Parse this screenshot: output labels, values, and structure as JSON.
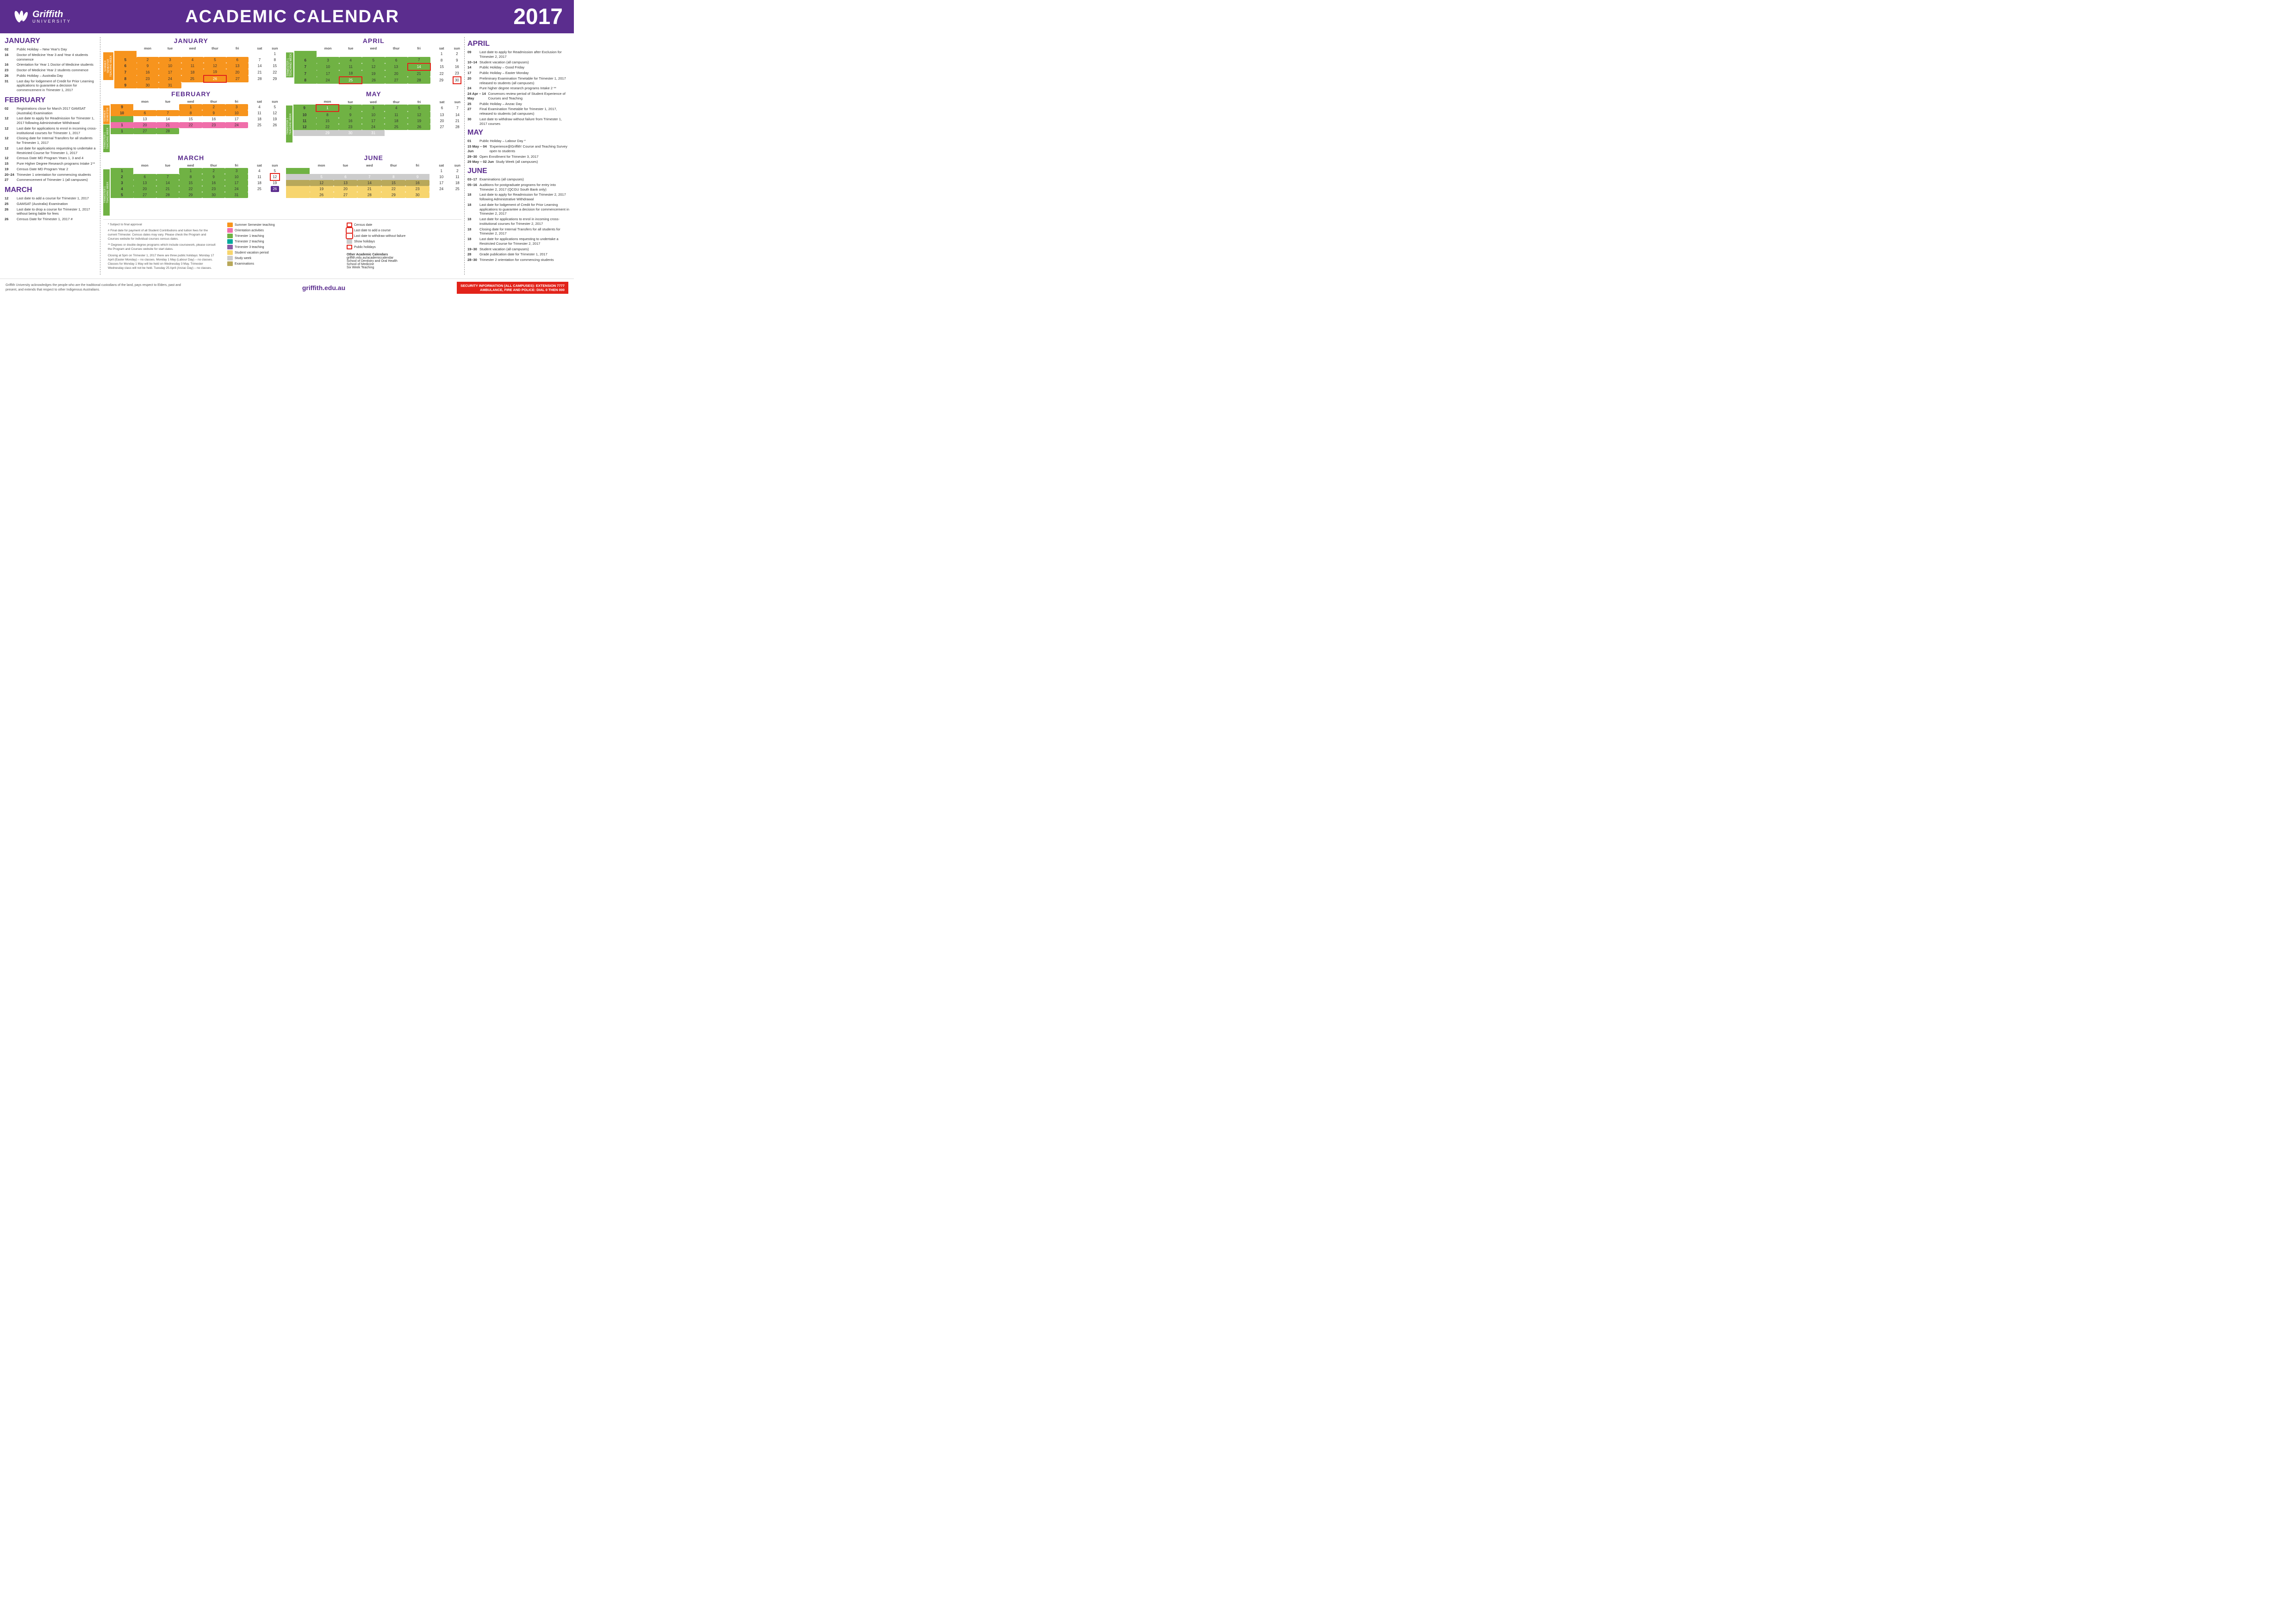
{
  "header": {
    "logo_name": "Griffith",
    "logo_sub": "UNIVERSITY",
    "title": "ACADEMIC CALENDAR",
    "year": "2017"
  },
  "left_events": {
    "january": {
      "heading": "JANUARY",
      "events": [
        {
          "date": "02",
          "text": "Public Holiday – New Year's Day"
        },
        {
          "date": "16",
          "text": "Doctor of Medicine Year 3 and Year 4 students commence"
        },
        {
          "date": "16",
          "text": "Orientation for Year 1 Doctor of Medicine students"
        },
        {
          "date": "23",
          "text": "Doctor of Medicine Year 2 students commence"
        },
        {
          "date": "26",
          "text": "Public Holiday – Australia Day"
        },
        {
          "date": "31",
          "text": "Last day for lodgement of Credit for Prior Learning applications to guarantee a decision for commencement in Trimester 1, 2017"
        }
      ]
    },
    "february": {
      "heading": "FEBRUARY",
      "events": [
        {
          "date": "02",
          "text": "Registrations close for March 2017 GAMSAT (Australia) Examination"
        },
        {
          "date": "12",
          "text": "Last date to apply for Readmission for Trimester 1, 2017 following Administrative Withdrawal"
        },
        {
          "date": "12",
          "text": "Last date for applications to enrol in incoming cross-institutional courses for Trimester 1, 2017"
        },
        {
          "date": "12",
          "text": "Closing date for Internal Transfers for all students for Trimester 1, 2017"
        },
        {
          "date": "12",
          "text": "Last date for applications requesting to undertake a Restricted Course for Trimester 1, 2017"
        },
        {
          "date": "12",
          "text": "Census Date MD Program Years 1, 3 and 4"
        },
        {
          "date": "15",
          "text": "Pure Higher Degree Research programs Intake 1**"
        },
        {
          "date": "19",
          "text": "Census Date MD Program Year 2"
        },
        {
          "date": "20–24",
          "text": "Trimester 1 orientation for commencing students"
        },
        {
          "date": "27",
          "text": "Commencement of Trimester 1 (all campuses)"
        }
      ]
    },
    "march": {
      "heading": "MARCH",
      "events": [
        {
          "date": "12",
          "text": "Last date to add a course for Trimester 1, 2017"
        },
        {
          "date": "25",
          "text": "GAMSAT (Australia) Examination"
        },
        {
          "date": "26",
          "text": "Last date to drop a course for Trimester 1, 2017 without being liable for fees"
        },
        {
          "date": "26",
          "text": "Census Date for Trimester 1, 2017 #"
        }
      ]
    }
  },
  "right_events": {
    "april": {
      "heading": "APRIL",
      "events": [
        {
          "date": "09",
          "text": "Last date to apply for Readmission after Exclusion for Trimester 2, 2017"
        },
        {
          "date": "10–14",
          "text": "Student vacation (all campuses)"
        },
        {
          "date": "14",
          "text": "Public Holiday – Good Friday"
        },
        {
          "date": "17",
          "text": "Public Holiday – Easter Monday"
        },
        {
          "date": "20",
          "text": "Preliminary Examination Timetable for Trimester 1, 2017 released to students (all campuses)"
        },
        {
          "date": "24",
          "text": "Pure higher degree research programs Intake 2 **"
        },
        {
          "date": "24 Apr – 14 May",
          "text": "Convenors review period of Student Experience of Courses and Teaching"
        },
        {
          "date": "25",
          "text": "Public Holiday – Anzac Day"
        },
        {
          "date": "27",
          "text": "Final Examination Timetable for Trimester 1, 2017, released to students (all campuses)"
        },
        {
          "date": "30",
          "text": "Last date to withdraw without failure from Trimester 1, 2017 courses"
        }
      ]
    },
    "may": {
      "heading": "MAY",
      "events": [
        {
          "date": "01",
          "text": "Public Holiday – Labour Day *"
        },
        {
          "date": "15 May – 04 Jun",
          "text": "'Experience@Griffith' Course and Teaching Survey open to students"
        },
        {
          "date": "29–30",
          "text": "Open Enrollment for Trimester 3, 2017"
        },
        {
          "date": "29 May – 02 Jun",
          "text": "Study Week (all campuses)"
        }
      ]
    },
    "june": {
      "heading": "JUNE",
      "events": [
        {
          "date": "03–17",
          "text": "Examinations (all campuses)"
        },
        {
          "date": "05–16",
          "text": "Auditions for postgraduate programs for entry into Trimester 2, 2017 (QCGU South Bank only)"
        },
        {
          "date": "18",
          "text": "Last date to apply for Readmission for Trimester 2, 2017 following Administrative Withdrawal"
        },
        {
          "date": "18",
          "text": "Last date for lodgement of Credit for Prior Learning applications to guarantee a decision for commencement in Trimester 2, 2017"
        },
        {
          "date": "18",
          "text": "Last date for applications to enrol in incoming cross-institutional courses for Trimester 2, 2017"
        },
        {
          "date": "18",
          "text": "Closing date for Internal Transfers for all students for Trimester 2, 2017"
        },
        {
          "date": "18",
          "text": "Last date for applications requesting to undertake a Restricted Course for Trimester 2, 2017"
        },
        {
          "date": "19–30",
          "text": "Student vacation (all campuses)"
        },
        {
          "date": "28",
          "text": "Grade publication date for Trimester 1, 2017"
        },
        {
          "date": "28–30",
          "text": "Trimester 2 orientation for commencing students"
        }
      ]
    }
  },
  "footer": {
    "left_text": "Griffith University acknowledges the people who are the traditional custodians of the land, pays respect to Elders, past and present, and extends that respect to other Indigenous Australians.",
    "center_text": "griffith.edu.au",
    "right_text": "SECURITY INFORMATION (ALL CAMPUSES): EXTENSION 7777\nAMBULANCE, FIRE AND POLICE: DIAL 0 THEN 000"
  },
  "legend": {
    "notes": [
      "* Subject to final approval",
      "# Final date for payment of all Student Contributions and tuition fees for the current Trimester. Census dates may vary. Please check the Program and Courses website for individual courses census dates.",
      "** Degrees or double degree programs which include coursework, please consult the Program and Courses website for start dates.",
      "Closing at 5pm on Trimester 1, 2017 there are three public holidays: Monday 17 April (Easter Monday) – no classes. Monday 1 May (Labour Day) – no classes. Classes for Monday 1 May will be held on Wednesday 3 May. Trimester Wednesday class will not be held. Tuesday 25 April (Anzac Day) – no classes."
    ],
    "items": [
      {
        "color": "lb-orange",
        "label": "Summer Semester teaching"
      },
      {
        "color": "lb-pink",
        "label": "Orientation activities"
      },
      {
        "color": "lb-green",
        "label": "Trimester 1 teaching"
      },
      {
        "color": "lb-teal",
        "label": "Trimester 2 teaching"
      },
      {
        "color": "lb-purple",
        "label": "Trimester 3 teaching"
      },
      {
        "color": "lb-yellow",
        "label": "Student vacation period"
      },
      {
        "color": "lb-gray",
        "label": "Study week"
      },
      {
        "color": "lb-olive",
        "label": "Examinations"
      }
    ],
    "items2": [
      {
        "color": "lb-red-border",
        "label": "Census date"
      },
      {
        "color": "lb-outline-red",
        "label": "Last date to add a course"
      },
      {
        "color": "lb-outline-red",
        "label": "Last date to withdraw without failure"
      },
      {
        "color": "lb-gray",
        "label": "Show holidays"
      },
      {
        "color": "lb-red-border",
        "label": "Public holidays"
      }
    ],
    "other_calendars": [
      "Other Academic Calendars",
      "griffith.edu.au/academiccalendar",
      "School of Dentistry and Oral Health",
      "School of Medicine",
      "Six Week Teaching"
    ]
  }
}
